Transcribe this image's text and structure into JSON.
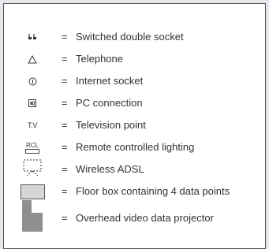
{
  "equals": "=",
  "items": [
    {
      "icon": "double-socket-icon",
      "label": "Switched double socket"
    },
    {
      "icon": "telephone-triangle-icon",
      "label": "Telephone"
    },
    {
      "icon": "internet-socket-icon",
      "label": "Internet socket"
    },
    {
      "icon": "pc-connection-icon",
      "label": "PC connection"
    },
    {
      "icon": "television-point-icon",
      "label": "Television point",
      "symbol_text": "T.V"
    },
    {
      "icon": "rcl-icon",
      "label": "Remote controlled lighting",
      "symbol_text": "RCL"
    },
    {
      "icon": "wireless-adsl-icon",
      "label": "Wireless ADSL"
    },
    {
      "icon": "floor-box-icon",
      "label": "Floor box containing 4 data points"
    },
    {
      "icon": "projector-icon",
      "label": "Overhead video data projector"
    }
  ]
}
